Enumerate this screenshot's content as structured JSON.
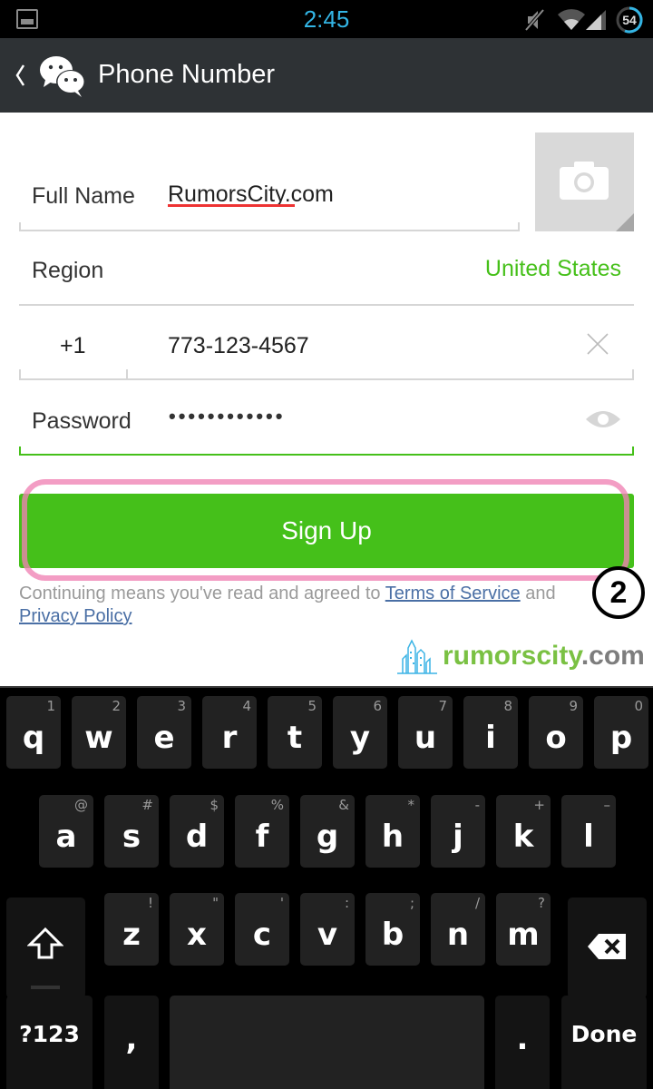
{
  "status_bar": {
    "time": "2:45",
    "battery_level": "54",
    "icons": [
      "gallery-notification-icon",
      "mute-icon",
      "wifi-icon",
      "cell-signal-icon",
      "battery-icon"
    ],
    "time_color": "#33b5e5"
  },
  "action_bar": {
    "back_icon": "chevron-left-icon",
    "logo_icon": "wechat-logo-icon",
    "title": "Phone Number"
  },
  "form": {
    "full_name": {
      "label": "Full Name",
      "value": "RumorsCity.com"
    },
    "avatar": {
      "icon": "camera-icon"
    },
    "region": {
      "label": "Region",
      "value": "United States"
    },
    "phone": {
      "country_code": "+1",
      "number": "773-123-4567",
      "clear_icon": "clear-x-icon"
    },
    "password": {
      "label": "Password",
      "masked_value": "••••••••••••",
      "toggle_icon": "eye-icon"
    },
    "signup_button": "Sign Up",
    "terms": {
      "prefix": "Continuing means you've read and agreed to ",
      "terms_link": "Terms of Service",
      "middle": " and",
      "privacy_link": "Privacy Policy"
    }
  },
  "annotation": {
    "step_number": "2"
  },
  "watermark": {
    "main": "rumorscity",
    "tld": ".com"
  },
  "colors": {
    "accent_green": "#45c01a",
    "region_green": "#46c01a",
    "link_blue": "#4a6fa5",
    "highlight_pink": "#f082b4",
    "actionbar": "#2e3235"
  },
  "keyboard": {
    "row1": [
      {
        "key": "q",
        "hint": "1"
      },
      {
        "key": "w",
        "hint": "2"
      },
      {
        "key": "e",
        "hint": "3"
      },
      {
        "key": "r",
        "hint": "4"
      },
      {
        "key": "t",
        "hint": "5"
      },
      {
        "key": "y",
        "hint": "6"
      },
      {
        "key": "u",
        "hint": "7"
      },
      {
        "key": "i",
        "hint": "8"
      },
      {
        "key": "o",
        "hint": "9"
      },
      {
        "key": "p",
        "hint": "0"
      }
    ],
    "row2": [
      {
        "key": "a",
        "hint": "@"
      },
      {
        "key": "s",
        "hint": "#"
      },
      {
        "key": "d",
        "hint": "$"
      },
      {
        "key": "f",
        "hint": "%"
      },
      {
        "key": "g",
        "hint": "&"
      },
      {
        "key": "h",
        "hint": "*"
      },
      {
        "key": "j",
        "hint": "-"
      },
      {
        "key": "k",
        "hint": "+"
      },
      {
        "key": "l",
        "hint": "–"
      }
    ],
    "row3": [
      {
        "key": "z",
        "hint": "!"
      },
      {
        "key": "x",
        "hint": "\""
      },
      {
        "key": "c",
        "hint": "'"
      },
      {
        "key": "v",
        "hint": ":"
      },
      {
        "key": "b",
        "hint": ";"
      },
      {
        "key": "n",
        "hint": "/"
      },
      {
        "key": "m",
        "hint": "?"
      }
    ],
    "shift_icon": "shift-arrow-icon",
    "backspace_icon": "backspace-icon",
    "symbols_key": "?123",
    "comma_key": ",",
    "period_key": ".",
    "done_key": "Done",
    "more_indicator": "..."
  }
}
